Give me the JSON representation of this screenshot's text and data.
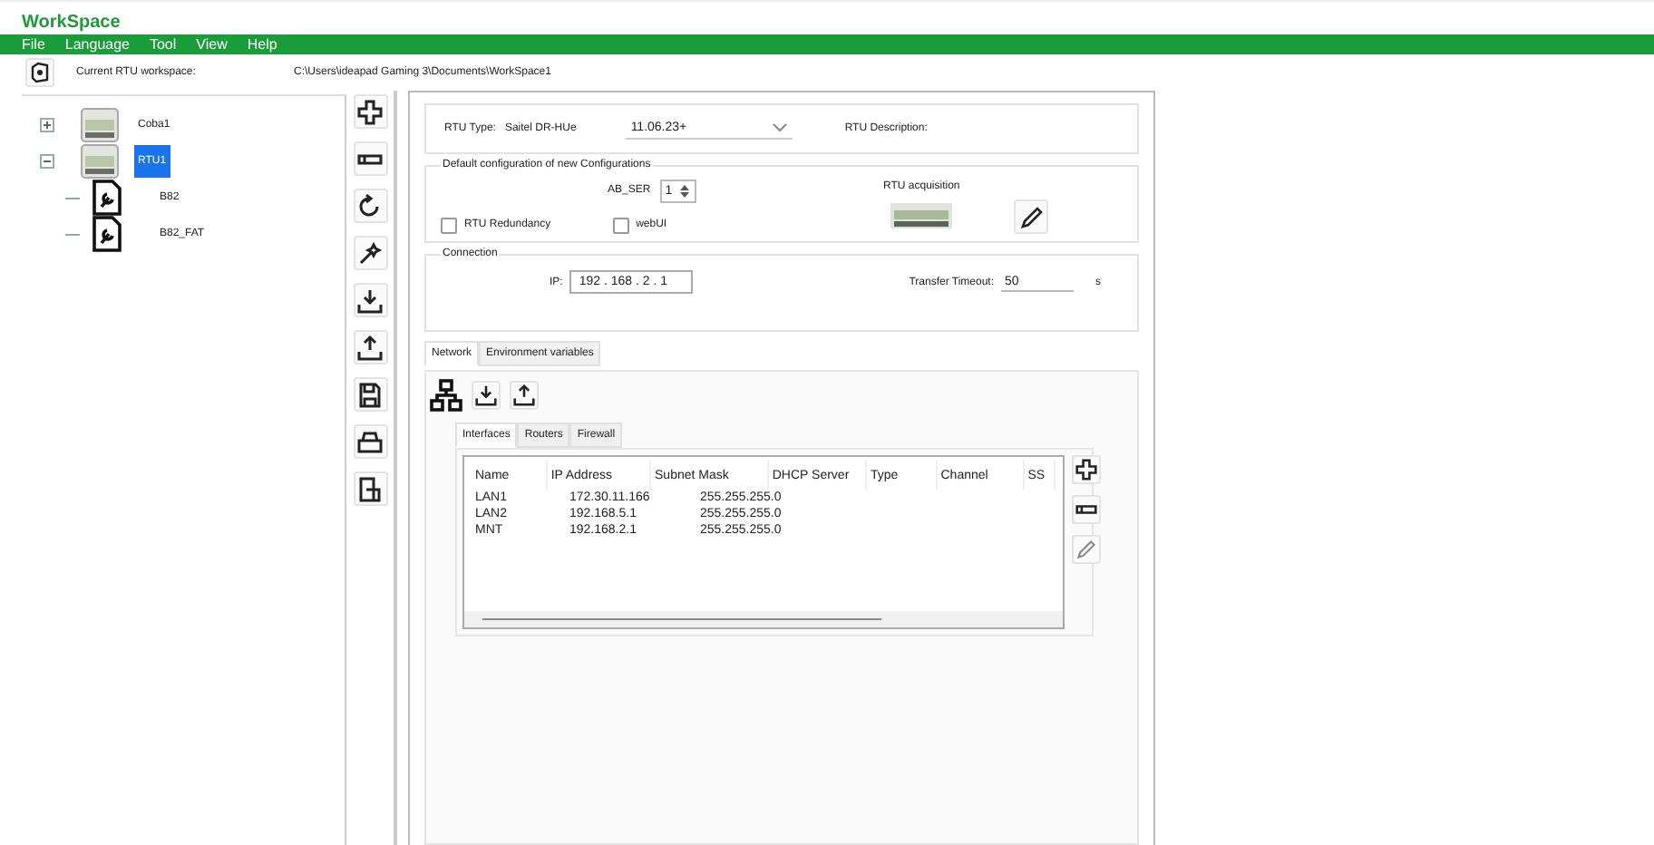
{
  "window": {
    "title": "WorkSpace"
  },
  "menu": [
    "File",
    "Language",
    "Tool",
    "View",
    "Help"
  ],
  "workspace": {
    "label": "Current RTU workspace:",
    "path": "C:\\Users\\ideapad Gaming 3\\Documents\\WorkSpace1"
  },
  "tree": [
    {
      "label": "Coba1",
      "kind": "device",
      "expanded": false,
      "selected": false
    },
    {
      "label": "RTU1",
      "kind": "device",
      "expanded": true,
      "selected": true,
      "children": [
        {
          "label": "B82",
          "kind": "config",
          "selected": false
        },
        {
          "label": "B82_FAT",
          "kind": "config",
          "selected": false
        }
      ]
    }
  ],
  "rtu": {
    "type_label": "RTU Type:",
    "type_value": "Saitel DR-HUe",
    "version": "11.06.23+",
    "description_label": "RTU Description:"
  },
  "defaults": {
    "title": "Default configuration of new Configurations",
    "ab_ser_label": "AB_SER",
    "ab_ser_value": "1",
    "acquisition_label": "RTU acquisition",
    "checkboxes": [
      {
        "label": "RTU Redundancy",
        "checked": false
      },
      {
        "label": "webUI",
        "checked": false
      }
    ]
  },
  "connection": {
    "title": "Connection",
    "ip_label": "IP:",
    "ip": "192 . 168 . 2 . 1",
    "timeout_label": "Transfer Timeout:",
    "timeout_value": "50",
    "timeout_unit": "s"
  },
  "tabs": [
    {
      "label": "Network",
      "selected": true
    },
    {
      "label": "Environment variables",
      "selected": false
    }
  ],
  "subtabs": [
    {
      "label": "Interfaces",
      "selected": true
    },
    {
      "label": "Routers",
      "selected": false
    },
    {
      "label": "Firewall",
      "selected": false
    }
  ],
  "table": {
    "columns": [
      "Name",
      "IP Address",
      "Subnet Mask",
      "DHCP Server",
      "Type",
      "Channel",
      "SS"
    ],
    "rows": [
      [
        "LAN1",
        "172.30.11.166",
        "255.255.255.0"
      ],
      [
        "LAN2",
        "192.168.5.1",
        "255.255.255.0"
      ],
      [
        "MNT",
        "192.168.2.1",
        "255.255.255.0"
      ]
    ]
  }
}
